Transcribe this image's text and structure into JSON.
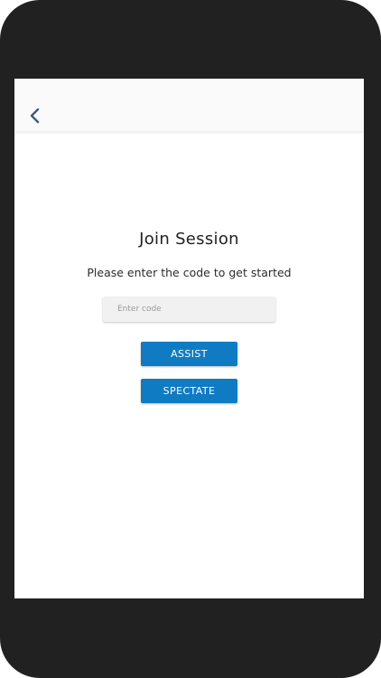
{
  "app_bar": {
    "back_icon": "chevron-left-icon"
  },
  "join": {
    "title": "Join Session",
    "subtitle": "Please enter the code to get started",
    "code_input": {
      "value": "",
      "placeholder": "Enter code"
    },
    "assist_label": "ASSIST",
    "spectate_label": "SPECTATE"
  },
  "colors": {
    "primary_button": "#0f7bc3",
    "device_frame": "#212121",
    "back_icon": "#3d5a80"
  }
}
